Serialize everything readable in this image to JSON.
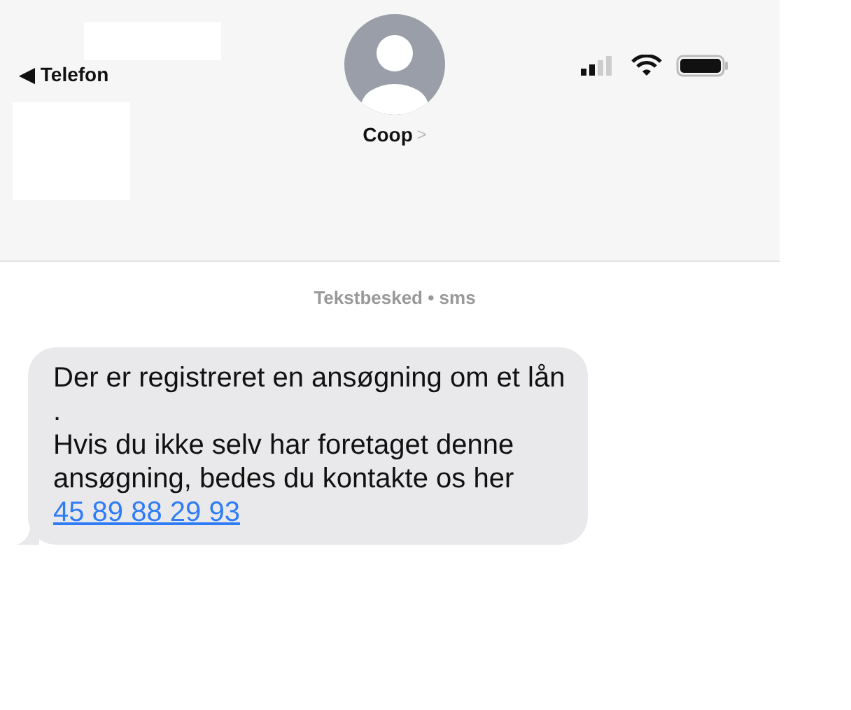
{
  "status_bar": {
    "back_label": "◀ Telefon"
  },
  "contact": {
    "name": "Coop",
    "chevron": ">"
  },
  "conversation": {
    "service_label": "Tekstbesked • sms",
    "messages": [
      {
        "text": "Der er registreret en ansøgning om et lån .\nHvis du ikke selv har foretaget denne ansøgning, bedes du kontakte os her ",
        "link": "45 89 88 29 93"
      }
    ]
  }
}
